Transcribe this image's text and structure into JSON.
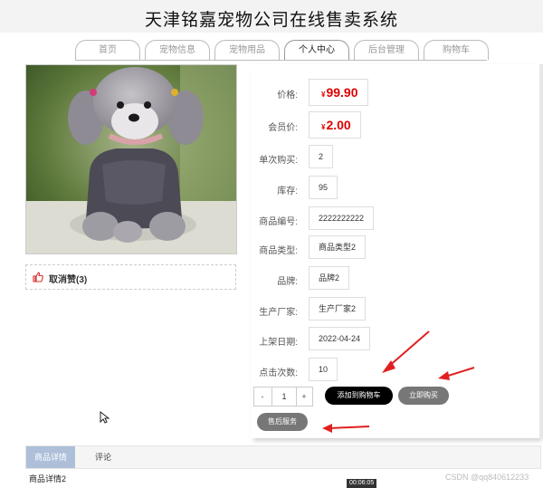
{
  "site_title": "天津铭嘉宠物公司在线售卖系统",
  "nav": {
    "tabs": [
      {
        "label": "首页",
        "active": false
      },
      {
        "label": "宠物信息",
        "active": false
      },
      {
        "label": "宠物用品",
        "active": false
      },
      {
        "label": "个人中心",
        "active": true
      },
      {
        "label": "后台管理",
        "active": false
      },
      {
        "label": "购物车",
        "active": false
      }
    ]
  },
  "product": {
    "like_label": "取消赞(3)",
    "price_label": "价格:",
    "currency": "¥",
    "price": "99.90",
    "member_price_label": "会员价:",
    "member_price": "2.00",
    "fields": [
      {
        "label": "单次购买:",
        "value": "2"
      },
      {
        "label": "库存:",
        "value": "95"
      },
      {
        "label": "商品编号:",
        "value": "2222222222"
      },
      {
        "label": "商品类型:",
        "value": "商品类型2"
      },
      {
        "label": "品牌:",
        "value": "品牌2"
      },
      {
        "label": "生产厂家:",
        "value": "生产厂家2"
      },
      {
        "label": "上架日期:",
        "value": "2022-04-24"
      },
      {
        "label": "点击次数:",
        "value": "10"
      }
    ]
  },
  "cart": {
    "minus": "-",
    "quantity": "1",
    "plus": "+",
    "add_to_cart": "添加到购物车",
    "buy_now": "立即购买",
    "after_sales": "售后服务"
  },
  "detail_tabs": {
    "detail": "商品详情",
    "comments": "评论",
    "detail_text": "商品详情2"
  },
  "overlay": {
    "video_time": "00:06:05",
    "watermark": "CSDN @qq840612233"
  },
  "colors": {
    "price_red": "#dd0000",
    "active_tab_blue": "#aebfd9",
    "arrow_red": "#e02020",
    "like_icon_red": "#d9302a"
  }
}
